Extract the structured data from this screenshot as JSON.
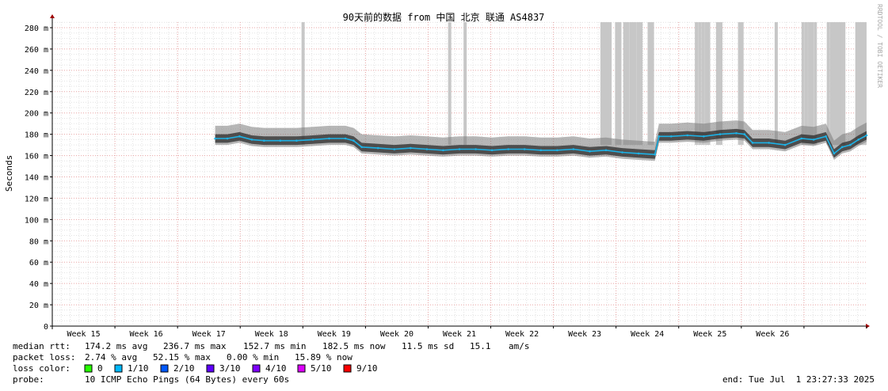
{
  "chart_data": {
    "type": "line",
    "title": "90天前的数据 from 中国 北京 联通 AS4837",
    "ylabel": "Seconds",
    "watermark": "RRDTOOL / TOBI OETIKER",
    "ylim": [
      0,
      285
    ],
    "yticks": [
      {
        "value": 0,
        "label": "0"
      },
      {
        "value": 20,
        "label": "20 m"
      },
      {
        "value": 40,
        "label": "40 m"
      },
      {
        "value": 60,
        "label": "60 m"
      },
      {
        "value": 80,
        "label": "80 m"
      },
      {
        "value": 100,
        "label": "100 m"
      },
      {
        "value": 120,
        "label": "120 m"
      },
      {
        "value": 140,
        "label": "140 m"
      },
      {
        "value": 160,
        "label": "160 m"
      },
      {
        "value": 180,
        "label": "180 m"
      },
      {
        "value": 200,
        "label": "200 m"
      },
      {
        "value": 220,
        "label": "220 m"
      },
      {
        "value": 240,
        "label": "240 m"
      },
      {
        "value": 260,
        "label": "260 m"
      },
      {
        "value": 280,
        "label": "280 m"
      }
    ],
    "week_labels": [
      "Week 15",
      "Week 16",
      "Week 17",
      "Week 18",
      "Week 19",
      "Week 20",
      "Week 21",
      "Week 22",
      "Week 23",
      "Week 24",
      "Week 25",
      "Week 26"
    ],
    "data_start_fraction": 0.2,
    "series": [
      {
        "color": "#1db2e6",
        "points": [
          [
            0.2,
            176
          ],
          [
            0.215,
            176
          ],
          [
            0.23,
            178
          ],
          [
            0.245,
            175
          ],
          [
            0.26,
            174
          ],
          [
            0.28,
            174
          ],
          [
            0.3,
            174
          ],
          [
            0.32,
            175
          ],
          [
            0.34,
            176
          ],
          [
            0.36,
            176
          ],
          [
            0.37,
            174
          ],
          [
            0.38,
            168
          ],
          [
            0.4,
            167
          ],
          [
            0.42,
            166
          ],
          [
            0.44,
            167
          ],
          [
            0.46,
            166
          ],
          [
            0.48,
            165
          ],
          [
            0.5,
            166
          ],
          [
            0.52,
            166
          ],
          [
            0.54,
            165
          ],
          [
            0.56,
            166
          ],
          [
            0.58,
            166
          ],
          [
            0.6,
            165
          ],
          [
            0.62,
            165
          ],
          [
            0.64,
            166
          ],
          [
            0.66,
            164
          ],
          [
            0.68,
            165
          ],
          [
            0.7,
            163
          ],
          [
            0.72,
            162
          ],
          [
            0.74,
            161
          ],
          [
            0.745,
            178
          ],
          [
            0.76,
            178
          ],
          [
            0.78,
            179
          ],
          [
            0.8,
            178
          ],
          [
            0.82,
            180
          ],
          [
            0.84,
            181
          ],
          [
            0.85,
            180
          ],
          [
            0.86,
            172
          ],
          [
            0.88,
            172
          ],
          [
            0.9,
            170
          ],
          [
            0.92,
            176
          ],
          [
            0.935,
            175
          ],
          [
            0.95,
            178
          ],
          [
            0.96,
            162
          ],
          [
            0.97,
            168
          ],
          [
            0.98,
            170
          ],
          [
            0.99,
            175
          ],
          [
            1.0,
            179
          ]
        ]
      }
    ],
    "stats": {
      "median_rtt": {
        "label": "median rtt:",
        "avg": "174.2 ms avg",
        "max": "236.7 ms max",
        "min": "152.7 ms min",
        "now": "182.5 ms now",
        "sd": "11.5 ms sd",
        "ams": "15.1",
        "ams_unit": "am/s"
      },
      "packet_loss": {
        "label": "packet loss:",
        "avg": "2.74 % avg",
        "max": "52.15 % max",
        "min": "0.00 % min",
        "now": "15.89 % now"
      },
      "loss_color": {
        "label": "loss color:",
        "items": [
          {
            "color": "#26ff00",
            "label": "0"
          },
          {
            "color": "#00b8ff",
            "label": "1/10"
          },
          {
            "color": "#0059ff",
            "label": "2/10"
          },
          {
            "color": "#5e00ff",
            "label": "3/10"
          },
          {
            "color": "#7e00ff",
            "label": "4/10"
          },
          {
            "color": "#dd00ff",
            "label": "5/10"
          },
          {
            "color": "#ff0000",
            "label": "9/10"
          }
        ]
      },
      "probe": {
        "label": "probe:",
        "text": "10 ICMP Echo Pings (64 Bytes) every 60s"
      },
      "end": "end: Tue Jul  1 23:27:33 2025"
    },
    "loss_spikes": [
      0.308,
      0.488,
      0.507,
      0.675,
      0.677,
      0.679,
      0.681,
      0.683,
      0.685,
      0.693,
      0.695,
      0.697,
      0.703,
      0.705,
      0.707,
      0.711,
      0.713,
      0.715,
      0.719,
      0.721,
      0.723,
      0.733,
      0.735,
      0.737,
      0.791,
      0.795,
      0.799,
      0.803,
      0.806,
      0.817,
      0.819,
      0.821,
      0.844,
      0.847,
      0.889,
      0.922,
      0.926,
      0.93,
      0.933,
      0.937,
      0.953,
      0.957,
      0.96,
      0.963,
      0.966,
      0.969,
      0.972,
      0.988,
      0.99,
      0.992,
      0.994,
      0.996,
      0.998
    ]
  }
}
